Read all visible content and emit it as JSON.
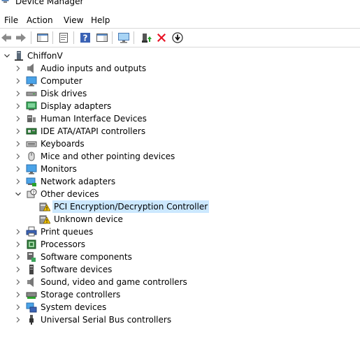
{
  "window": {
    "title": "Device Manager"
  },
  "menu": {
    "file": "File",
    "action": "Action",
    "view": "View",
    "help": "Help"
  },
  "toolbar": {
    "buttons": [
      "back-arrow-icon",
      "forward-arrow-icon",
      "show-hide-console-tree-icon",
      "properties-icon",
      "help-icon",
      "action-pane-icon",
      "scan-hardware-icon",
      "update-driver-icon",
      "uninstall-device-icon",
      "disable-device-icon"
    ]
  },
  "tree": {
    "root": "ChiffonV",
    "categories": [
      {
        "label": "Audio inputs and outputs",
        "icon": "speaker-icon",
        "expanded": false
      },
      {
        "label": "Computer",
        "icon": "monitor-icon",
        "expanded": false
      },
      {
        "label": "Disk drives",
        "icon": "disk-drive-icon",
        "expanded": false
      },
      {
        "label": "Display adapters",
        "icon": "display-adapter-icon",
        "expanded": false
      },
      {
        "label": "Human Interface Devices",
        "icon": "hid-icon",
        "expanded": false
      },
      {
        "label": "IDE ATA/ATAPI controllers",
        "icon": "ide-controller-icon",
        "expanded": false
      },
      {
        "label": "Keyboards",
        "icon": "keyboard-icon",
        "expanded": false
      },
      {
        "label": "Mice and other pointing devices",
        "icon": "mouse-icon",
        "expanded": false
      },
      {
        "label": "Monitors",
        "icon": "monitor-icon",
        "expanded": false
      },
      {
        "label": "Network adapters",
        "icon": "network-adapter-icon",
        "expanded": false
      },
      {
        "label": "Other devices",
        "icon": "unknown-device-icon",
        "expanded": true,
        "children": [
          {
            "label": "PCI Encryption/Decryption Controller",
            "icon": "warning-device-icon",
            "selected": true
          },
          {
            "label": "Unknown device",
            "icon": "warning-device-icon",
            "selected": false
          }
        ]
      },
      {
        "label": "Print queues",
        "icon": "printer-icon",
        "expanded": false
      },
      {
        "label": "Processors",
        "icon": "processor-icon",
        "expanded": false
      },
      {
        "label": "Software components",
        "icon": "software-component-icon",
        "expanded": false
      },
      {
        "label": "Software devices",
        "icon": "software-device-icon",
        "expanded": false
      },
      {
        "label": "Sound, video and game controllers",
        "icon": "speaker-icon",
        "expanded": false
      },
      {
        "label": "Storage controllers",
        "icon": "storage-controller-icon",
        "expanded": false
      },
      {
        "label": "System devices",
        "icon": "system-devices-icon",
        "expanded": false
      },
      {
        "label": "Universal Serial Bus controllers",
        "icon": "usb-icon",
        "expanded": false
      }
    ]
  },
  "colors": {
    "selection": "#cce8ff",
    "accent_blue": "#1e78c8",
    "uninstall_red": "#e81123",
    "update_green": "#2aa02a"
  }
}
